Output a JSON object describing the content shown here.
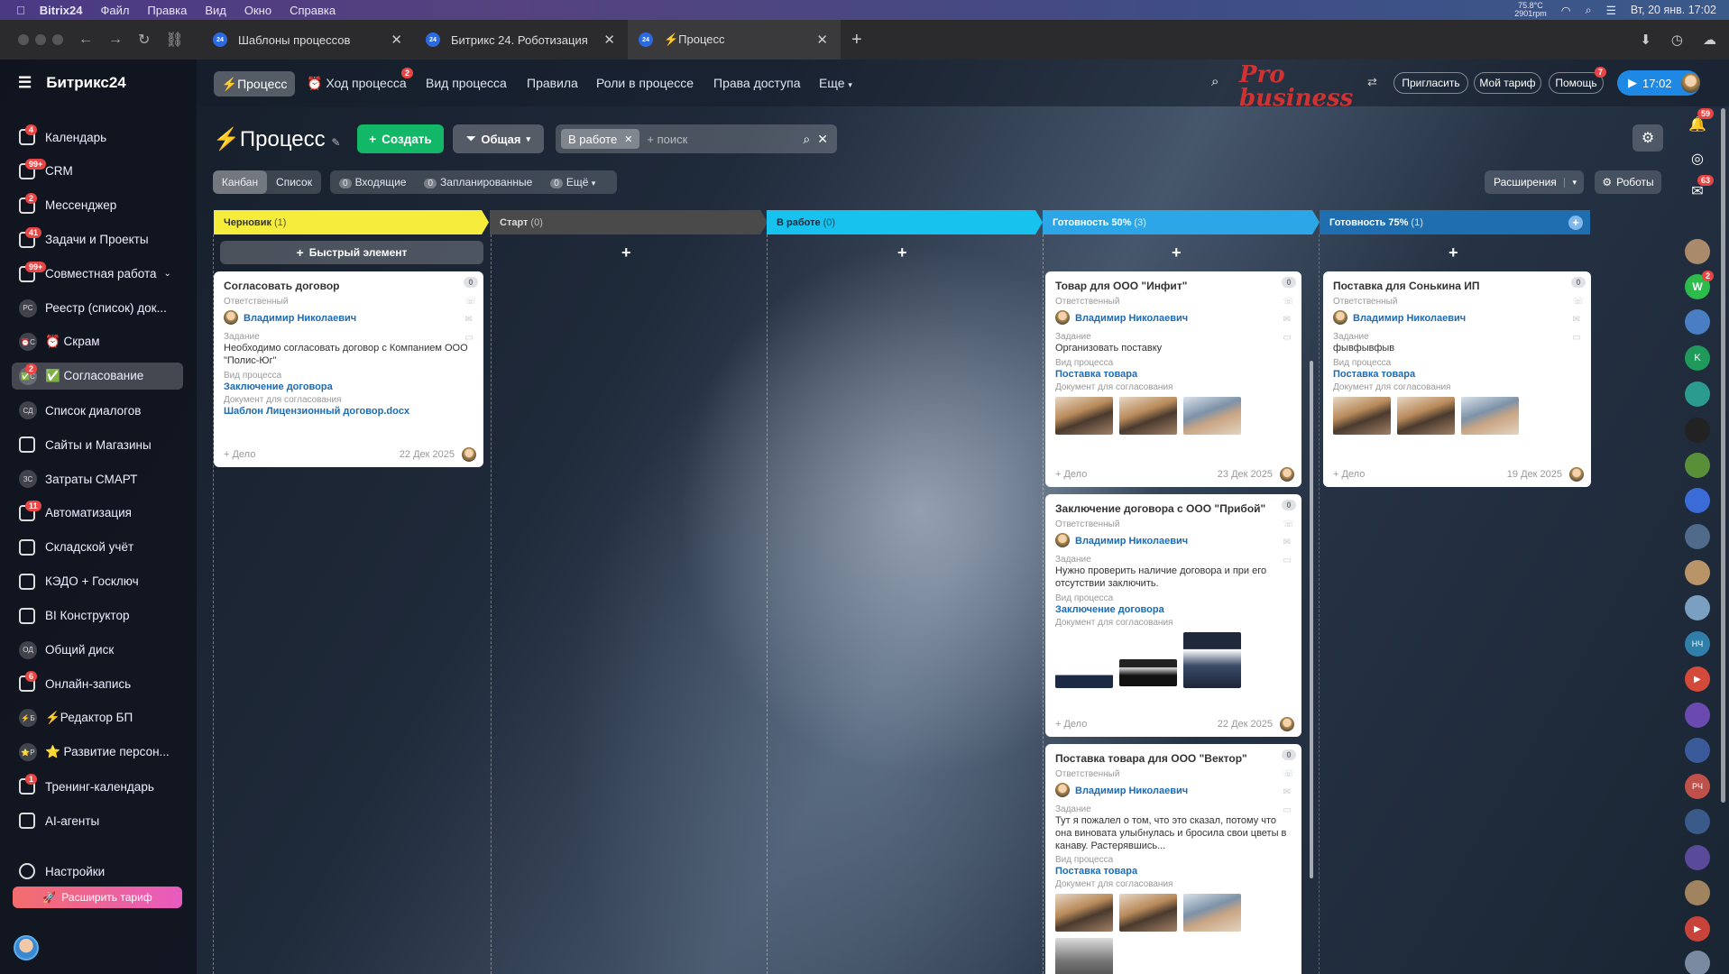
{
  "macmenu": {
    "app": "Bitrix24",
    "items": [
      "Файл",
      "Правка",
      "Вид",
      "Окно",
      "Справка"
    ],
    "temp": "75.8°C",
    "rpm": "2901rpm",
    "datetime": "Вт, 20 янв.  17:02"
  },
  "browser": {
    "tabs": [
      {
        "label": "Шаблоны процессов",
        "active": false
      },
      {
        "label": "Битрикс 24. Роботизация",
        "active": false
      },
      {
        "label": "⚡Процесс",
        "active": true
      }
    ]
  },
  "sidebar": {
    "brand": "Битрикс24",
    "items": [
      {
        "label": "Календарь",
        "badge": "4",
        "icon": "calendar-icon"
      },
      {
        "label": "CRM",
        "badge": "99+",
        "icon": "crm-icon"
      },
      {
        "label": "Мессенджер",
        "badge": "2",
        "icon": "messenger-icon"
      },
      {
        "label": "Задачи и Проекты",
        "badge": "41",
        "icon": "tasks-icon"
      },
      {
        "label": "Совместная работа",
        "badge": "99+",
        "icon": "collab-icon",
        "chevron": true
      },
      {
        "label": "Реестр (список) док...",
        "abbr": "РС",
        "icon": "registry-icon"
      },
      {
        "label": "⏰ Скрам",
        "abbr": "⏰С",
        "icon": "scrum-icon"
      },
      {
        "label": "✅ Согласование",
        "abbr": "✅С",
        "badge": "2",
        "icon": "approval-icon",
        "active": true
      },
      {
        "label": "Список диалогов",
        "abbr": "СД",
        "icon": "dialogs-icon"
      },
      {
        "label": "Сайты и Магазины",
        "icon": "cart-icon"
      },
      {
        "label": "Затраты СМАРТ",
        "abbr": "ЗС",
        "icon": "costs-icon"
      },
      {
        "label": "Автоматизация",
        "badge": "11",
        "icon": "automation-icon"
      },
      {
        "label": "Складской учёт",
        "icon": "warehouse-icon"
      },
      {
        "label": "КЭДО + Госключ",
        "icon": "kedo-icon"
      },
      {
        "label": "BI Конструктор",
        "icon": "bi-icon"
      },
      {
        "label": "Общий диск",
        "abbr": "ОД",
        "icon": "disk-icon"
      },
      {
        "label": "Онлайн-запись",
        "badge": "6",
        "icon": "booking-icon"
      },
      {
        "label": "⚡Редактор БП",
        "abbr": "⚡Б",
        "icon": "bp-editor-icon"
      },
      {
        "label": "⭐ Развитие персон...",
        "abbr": "⭐Р",
        "icon": "staff-icon"
      },
      {
        "label": "Тренинг-календарь",
        "badge": "1",
        "icon": "training-icon"
      },
      {
        "label": "AI-агенты",
        "icon": "ai-icon"
      }
    ],
    "settings": "Настройки",
    "upgrade": "Расширить тариф"
  },
  "topnav": {
    "items": [
      "⚡Процесс",
      "Ход процесса",
      "Вид процесса",
      "Правила",
      "Роли в процессе",
      "Права доступа",
      "Еще"
    ],
    "progress_badge": "2",
    "logo": "Pro business",
    "invite": "Пригласить",
    "tariff": "Мой тариф",
    "help": "Помощь",
    "help_badge": "7",
    "clock": "17:02"
  },
  "toolbar": {
    "title": "⚡Процесс",
    "create": "Создать",
    "general": "Общая",
    "filter_chip": "В работе",
    "search_placeholder": "+ поиск"
  },
  "viewbar": {
    "kanban": "Канбан",
    "list": "Список",
    "incoming_count": "0",
    "incoming": "Входящие",
    "planned_count": "0",
    "planned": "Запланированные",
    "more_count": "0",
    "more": "Ещё",
    "extensions": "Расширения",
    "robots": "Роботы"
  },
  "columns": [
    {
      "name": "Черновик",
      "count": "(1)",
      "color": "#f6ec3c",
      "text": "#333"
    },
    {
      "name": "Старт",
      "count": "(0)",
      "color": "#4a4a4a",
      "text": "#ddd"
    },
    {
      "name": "В работе",
      "count": "(0)",
      "color": "#17c2ef",
      "text": "#1a2a3a"
    },
    {
      "name": "Готовность 50%",
      "count": "(3)",
      "color": "#2da6e7",
      "text": "#fff"
    },
    {
      "name": "Готовность 75%",
      "count": "(1)",
      "color": "#1f6fb0",
      "text": "#fff"
    }
  ],
  "quick_add": "Быстрый элемент",
  "labels": {
    "resp": "Ответственный",
    "task": "Задание",
    "kind": "Вид процесса",
    "doc": "Документ для согласования",
    "add": "+ Дело"
  },
  "cards": {
    "c1": {
      "title": "Согласовать договор",
      "count": "0",
      "person": "Владимир Николаевич",
      "task": "Необходимо согласовать договор с Компанием ООО \"Полис-Юг\"",
      "kind": "Заключение договора",
      "doc": "Шаблон Лицензионный договор.docx",
      "date": "22 Дек 2025"
    },
    "c2": {
      "title": "Товар для ООО \"Инфит\"",
      "count": "0",
      "person": "Владимир Николаевич",
      "task": "Организовать поставку",
      "kind": "Поставка товара",
      "date": "23 Дек 2025"
    },
    "c3": {
      "title": "Заключение договора с ООО \"Прибой\"",
      "count": "0",
      "person": "Владимир Николаевич",
      "task": "Нужно проверить наличие договора и при его отсутствии заключить.",
      "kind": "Заключение договора",
      "date": "22 Дек 2025"
    },
    "c4": {
      "title": "Поставка товара для ООО \"Вектор\"",
      "count": "0",
      "person": "Владимир Николаевич",
      "task": "Тут я пожалел о том, что это сказал, потому что она виновата улыбнулась и бросила свои цветы в канаву. Растерявшись...",
      "kind": "Поставка товара"
    },
    "c5": {
      "title": "Поставка для Сонькина ИП",
      "count": "0",
      "person": "Владимир Николаевич",
      "task": "фывфывфыв",
      "kind": "Поставка товара",
      "date": "19 Дек 2025"
    }
  },
  "rail": {
    "notif_badge": "59",
    "chat_badge": "63",
    "w_badge": "2",
    "w_letter": "W",
    "k_letter": "K",
    "nch": "НЧ",
    "rch": "РЧ"
  }
}
